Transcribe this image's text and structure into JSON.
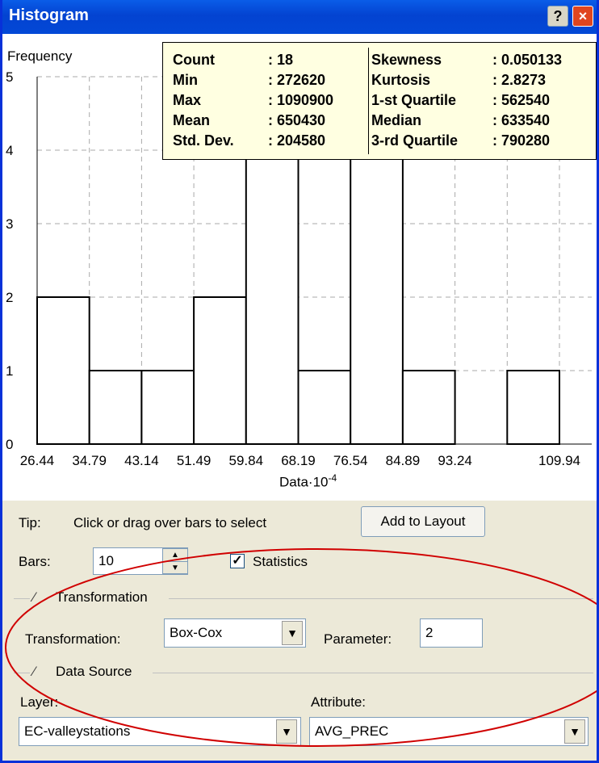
{
  "window": {
    "title": "Histogram",
    "help_label": "?",
    "close_label": "×"
  },
  "chart_data": {
    "type": "bar",
    "ylabel": "Frequency",
    "xlabel": "Data·10",
    "xlabel_exp": "-4",
    "yticks": [
      "0",
      "1",
      "2",
      "3",
      "4",
      "5"
    ],
    "ylim": [
      0,
      5
    ],
    "bin_edges": [
      "26.44",
      "34.79",
      "43.14",
      "51.49",
      "59.84",
      "68.19",
      "76.54",
      "84.89",
      "93.24",
      "",
      "109.94"
    ],
    "values": [
      2,
      1,
      1,
      2,
      4,
      1,
      4,
      1,
      0,
      1
    ],
    "selected_bins": [
      4,
      6
    ],
    "grid": true
  },
  "stats": {
    "left": [
      {
        "label": "Count",
        "value": ": 18"
      },
      {
        "label": "Min",
        "value": ": 272620"
      },
      {
        "label": "Max",
        "value": ": 1090900"
      },
      {
        "label": "Mean",
        "value": ": 650430"
      },
      {
        "label": "Std. Dev.",
        "value": ": 204580"
      }
    ],
    "right": [
      {
        "label": "Skewness",
        "value": ": 0.050133"
      },
      {
        "label": "Kurtosis",
        "value": ": 2.8273"
      },
      {
        "label": "1-st Quartile",
        "value": ": 562540"
      },
      {
        "label": "Median",
        "value": ": 633540"
      },
      {
        "label": "3-rd Quartile",
        "value": ": 790280"
      }
    ]
  },
  "controls": {
    "tip_label": "Tip:",
    "tip_text": "Click or drag over bars to select",
    "add_layout": "Add to Layout",
    "bars_label": "Bars:",
    "bars_value": "10",
    "statistics_label": "Statistics",
    "statistics_checked": true,
    "transformation_group": "Transformation",
    "transformation_label": "Transformation:",
    "transformation_value": "Box-Cox",
    "parameter_label": "Parameter:",
    "parameter_value": "2",
    "datasource_group": "Data Source",
    "layer_label": "Layer:",
    "layer_value": "EC-valleystations",
    "attribute_label": "Attribute:",
    "attribute_value": "AVG_PREC"
  },
  "colors": {
    "titlebar": "#0343d1",
    "annotation": "#d00000",
    "stats_bg": "#ffffe1"
  }
}
